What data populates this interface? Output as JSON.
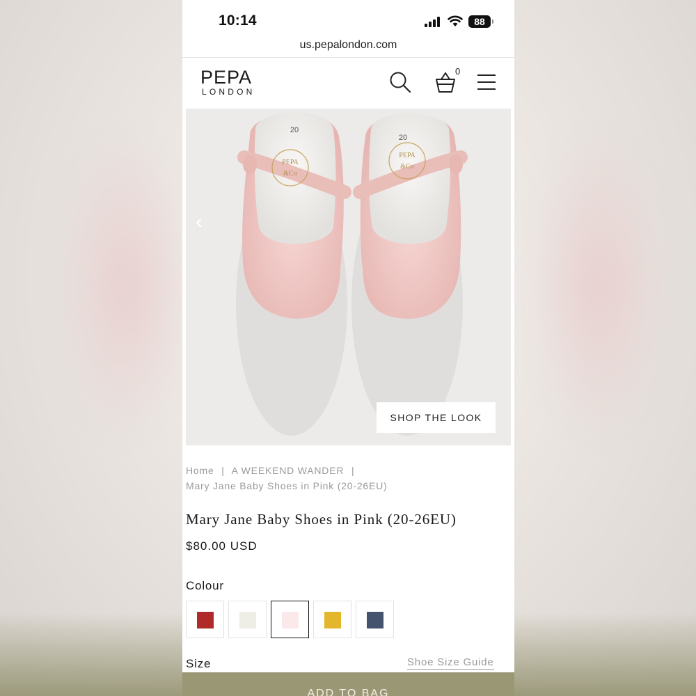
{
  "status_bar": {
    "time": "10:14",
    "battery": "88"
  },
  "browser": {
    "url": "us.pepalondon.com"
  },
  "header": {
    "logo_main": "PEPA",
    "logo_sub": "LONDON",
    "cart_count": "0"
  },
  "hero": {
    "shop_the_look": "SHOP THE LOOK",
    "insole_size": "20",
    "insole_brand_top": "PEPA",
    "insole_brand_bottom": "&Co"
  },
  "breadcrumb": {
    "home": "Home",
    "separator": "|",
    "collection": "A WEEKEND WANDER",
    "current": "Mary Jane Baby Shoes in Pink (20-26EU)"
  },
  "product": {
    "title": "Mary Jane Baby Shoes in Pink (20-26EU)",
    "price": "$80.00 USD",
    "colour_label": "Colour",
    "colours": [
      {
        "name": "red",
        "hex": "#b02a2a",
        "selected": false
      },
      {
        "name": "ivory",
        "hex": "#efeee6",
        "selected": false
      },
      {
        "name": "pink",
        "hex": "#fbe8ea",
        "selected": true
      },
      {
        "name": "yellow",
        "hex": "#e4b62b",
        "selected": false
      },
      {
        "name": "navy",
        "hex": "#46536f",
        "selected": false
      }
    ],
    "size_label": "Size",
    "size_guide": "Shoe Size Guide",
    "add_to_bag": "ADD TO BAG"
  },
  "colors": {
    "accent_button": "#9a9775",
    "shoe_pink": "#f0c8c5"
  }
}
